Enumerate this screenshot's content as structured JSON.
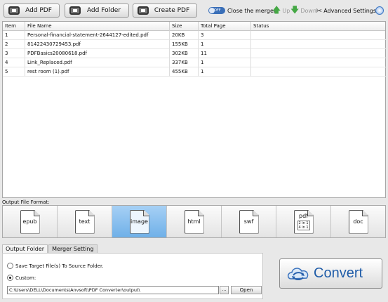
{
  "toolbar": {
    "add_pdf": "Add PDF",
    "add_folder": "Add Folder",
    "create_pdf": "Create PDF",
    "toggle_state": "OFF",
    "close_merger": "Close the merger",
    "up": "Up",
    "down": "Down",
    "advanced_settings": "Advanced Settings"
  },
  "table": {
    "headers": [
      "Item",
      "File Name",
      "Size",
      "Total Page",
      "Status"
    ],
    "rows": [
      {
        "item": "1",
        "file": "Personal-financial-statement-2644127-edited.pdf",
        "size": "20KB",
        "pages": "3",
        "status": ""
      },
      {
        "item": "2",
        "file": "81422430729453.pdf",
        "size": "155KB",
        "pages": "1",
        "status": ""
      },
      {
        "item": "3",
        "file": "PDFBasics20080618.pdf",
        "size": "302KB",
        "pages": "11",
        "status": ""
      },
      {
        "item": "4",
        "file": "Link_Replaced.pdf",
        "size": "337KB",
        "pages": "1",
        "status": ""
      },
      {
        "item": "5",
        "file": "rest room (1).pdf",
        "size": "455KB",
        "pages": "1",
        "status": ""
      }
    ]
  },
  "output_format": {
    "label": "Output File Format:",
    "formats": [
      "epub",
      "text",
      "image",
      "html",
      "swf",
      "pdf",
      "doc"
    ],
    "selected": "image",
    "pdf_sub": "2 in 1\n4 in 1"
  },
  "tabs": [
    "Output Folder",
    "Merger Setting"
  ],
  "output_folder": {
    "option_source": "Save Target File(s) To Source Folder.",
    "option_custom": "Custom:",
    "selected": "custom",
    "path": "C:\\Users\\DELL\\Documents\\Anvsoft\\PDF Converter\\output\\",
    "browse": "...",
    "open": "Open"
  },
  "convert": {
    "label": "Convert"
  },
  "colors": {
    "accent": "#1f5ca8",
    "selected_format": "#6fb0e8",
    "arrow": "#45a845"
  }
}
